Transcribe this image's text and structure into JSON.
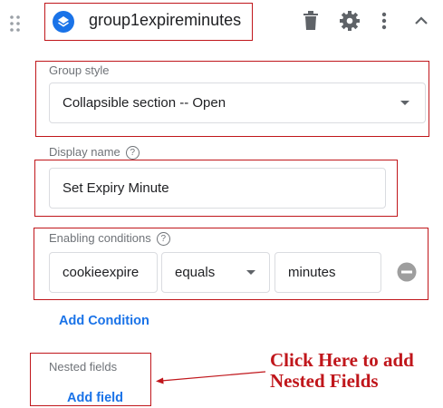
{
  "header": {
    "group_name": "group1expireminutes",
    "icons": [
      "drag-handle-icon",
      "layers-icon",
      "delete-icon",
      "gear-icon",
      "more-vert-icon",
      "chevron-up-icon"
    ]
  },
  "group_style": {
    "label": "Group style",
    "value": "Collapsible section -- Open"
  },
  "display_name": {
    "label": "Display name",
    "value": "Set Expiry Minute"
  },
  "enabling_conditions": {
    "label": "Enabling conditions",
    "variable": "cookieexpire",
    "operator": "equals",
    "value": "minutes",
    "add_label": "Add Condition"
  },
  "nested_fields": {
    "label": "Nested fields",
    "add_label": "Add field"
  },
  "annotation": {
    "line1": "Click Here to add",
    "line2": "Nested Fields"
  },
  "colors": {
    "accent": "#1a73e8",
    "annotation": "#c0161b",
    "icon": "#5f6368"
  }
}
